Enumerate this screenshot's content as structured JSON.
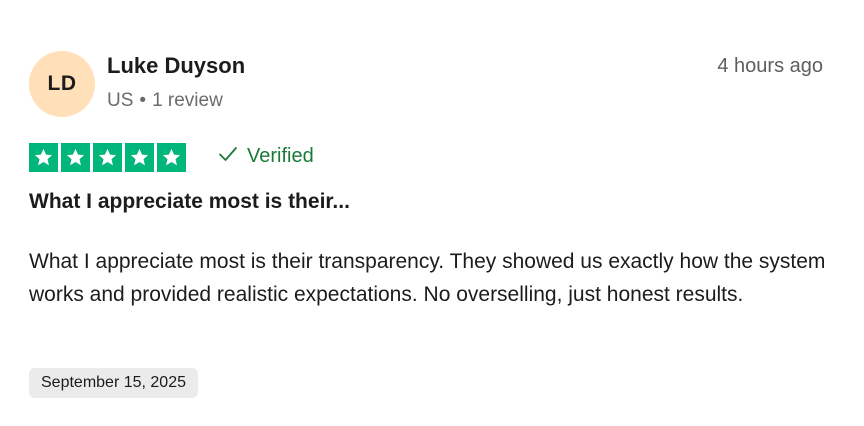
{
  "reviewer": {
    "initials": "LD",
    "name": "Luke Duyson",
    "country": "US",
    "separator": "•",
    "review_count": "1 review",
    "avatar_color": "#FFE0B8"
  },
  "review": {
    "time_ago": "4 hours ago",
    "rating": 5,
    "rating_max": 5,
    "star_color": "#00B67A",
    "verified_label": "Verified",
    "verified_color": "#1B7A3A",
    "title": "What I appreciate most is their...",
    "body": "What I appreciate most is their transparency. They showed us exactly how the system works and provided realistic expectations. No overselling, just honest results.",
    "date": "September 15, 2025",
    "date_badge_color": "#EBEBEB"
  },
  "icons": {
    "star": "star-icon",
    "verified": "checkmark-icon"
  }
}
